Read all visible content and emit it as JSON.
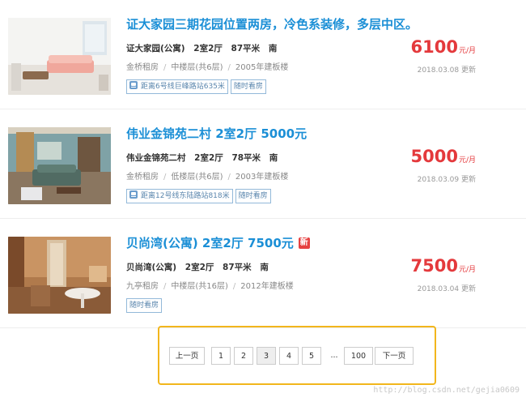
{
  "listings": [
    {
      "title": "证大家园三期花园位置两房，冷色系装修，多层中区。",
      "is_new": false,
      "attrs": [
        "证大家园(公寓)",
        "2室2厅",
        "87平米",
        "南"
      ],
      "meta": [
        "金桥租房",
        "中楼层(共6层)",
        "2005年建板楼"
      ],
      "tags": [
        {
          "label": "距离6号线巨峰路站635米",
          "metro": true
        },
        {
          "label": "随时看房",
          "metro": false
        }
      ],
      "price": "6100",
      "price_unit": "元/月",
      "updated": "2018.03.08 更新"
    },
    {
      "title": "伟业金锦苑二村 2室2厅 5000元",
      "is_new": false,
      "attrs": [
        "伟业金锦苑二村",
        "2室2厅",
        "78平米",
        "南"
      ],
      "meta": [
        "金桥租房",
        "低楼层(共6层)",
        "2003年建板楼"
      ],
      "tags": [
        {
          "label": "距离12号线东陆路站818米",
          "metro": true
        },
        {
          "label": "随时看房",
          "metro": false
        }
      ],
      "price": "5000",
      "price_unit": "元/月",
      "updated": "2018.03.09 更新"
    },
    {
      "title": "贝尚湾(公寓) 2室2厅 7500元",
      "is_new": true,
      "new_label": "新",
      "attrs": [
        "贝尚湾(公寓)",
        "2室2厅",
        "87平米",
        "南"
      ],
      "meta": [
        "九亭租房",
        "中楼层(共16层)",
        "2012年建板楼"
      ],
      "tags": [
        {
          "label": "随时看房",
          "metro": false
        }
      ],
      "price": "7500",
      "price_unit": "元/月",
      "updated": "2018.03.04 更新"
    }
  ],
  "pagination": {
    "prev": "上一页",
    "pages": [
      "1",
      "2",
      "3",
      "4",
      "5"
    ],
    "current": "3",
    "ellipsis": "...",
    "last": "100",
    "next": "下一页"
  },
  "watermark": "http://blog.csdn.net/gejia0609",
  "colors": {
    "title": "#1b8fd6",
    "price": "#e4393c",
    "highlight_border": "#f2b61c"
  }
}
